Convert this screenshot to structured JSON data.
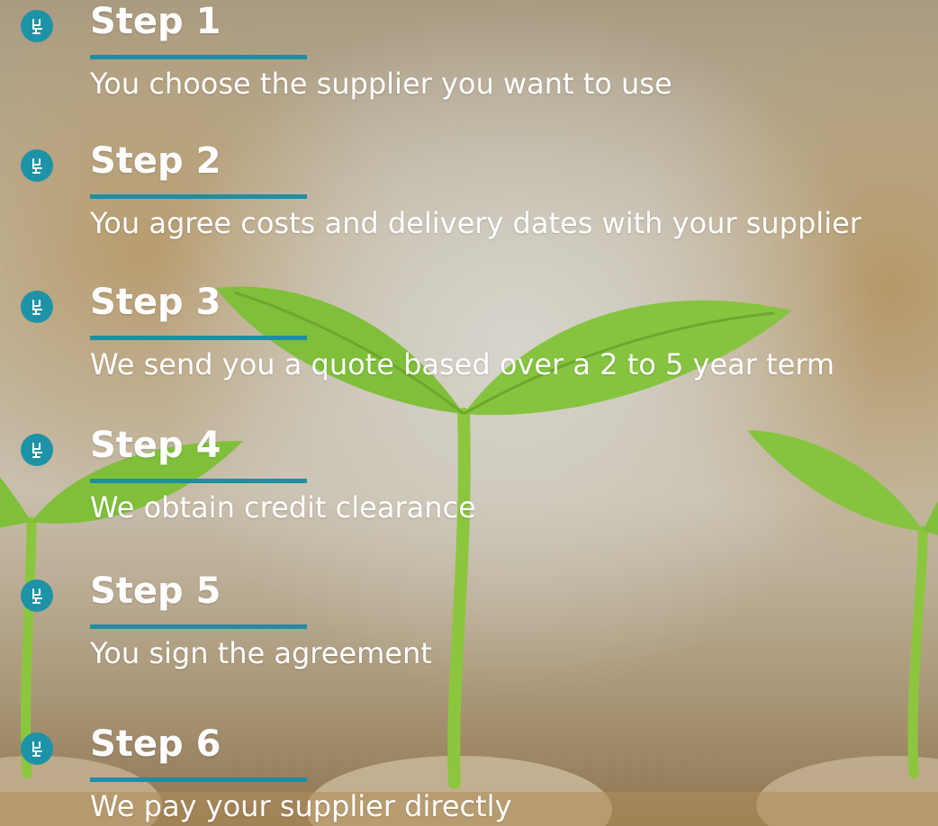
{
  "accent_color": "#1e93a8",
  "step_icon": "chair-icon",
  "steps": [
    {
      "title": "Step 1",
      "description": "You choose the supplier you want to use"
    },
    {
      "title": "Step 2",
      "description": "You agree costs and delivery dates with your supplier"
    },
    {
      "title": "Step 3",
      "description": "We send you a quote based over a 2 to 5 year term"
    },
    {
      "title": "Step 4",
      "description": "We obtain credit clearance"
    },
    {
      "title": "Step 5",
      "description": "You sign the agreement"
    },
    {
      "title": "Step 6",
      "description": "We pay your supplier directly"
    }
  ]
}
